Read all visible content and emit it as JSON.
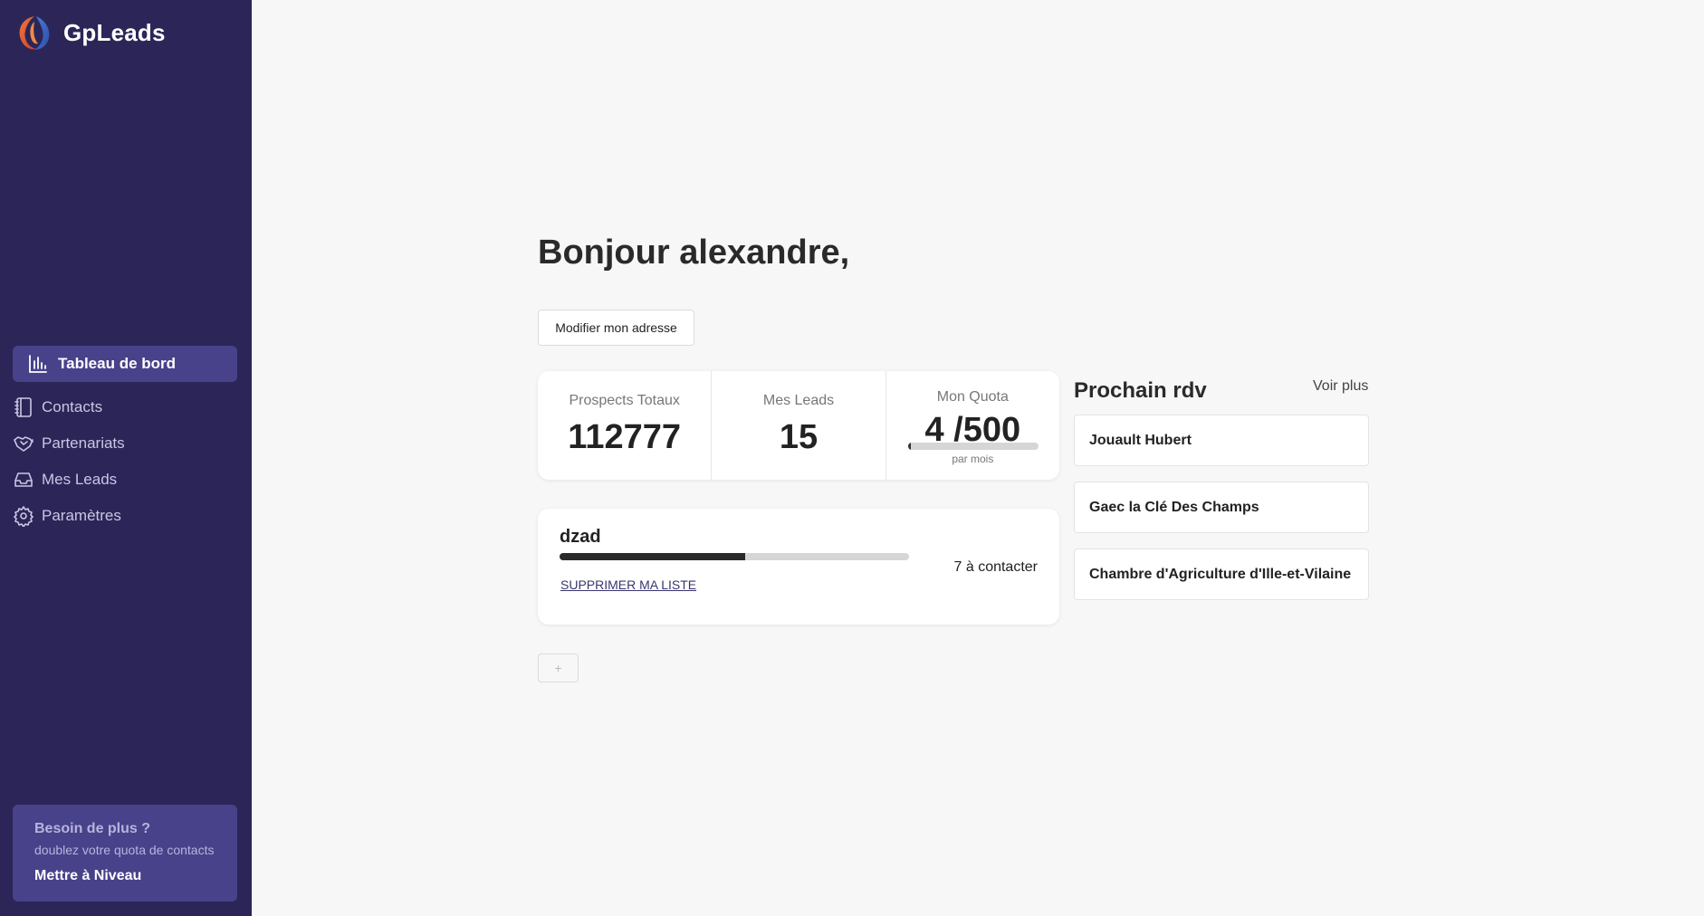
{
  "app": {
    "name": "GpLeads"
  },
  "sidebar": {
    "items": [
      {
        "label": "Tableau de bord",
        "icon": "bar-chart-icon",
        "active": true
      },
      {
        "label": "Contacts",
        "icon": "address-book-icon"
      },
      {
        "label": "Partenariats",
        "icon": "handshake-icon"
      },
      {
        "label": "Mes Leads",
        "icon": "inbox-icon"
      },
      {
        "label": "Paramètres",
        "icon": "gear-icon"
      }
    ],
    "upgrade": {
      "title": "Besoin de plus ?",
      "subtitle": "doublez votre quota de contacts",
      "button": "Mettre à Niveau"
    }
  },
  "main": {
    "greeting": "Bonjour alexandre,",
    "address_button": "Modifier mon adresse",
    "stats": {
      "prospects_label": "Prospects Totaux",
      "prospects_value": "112777",
      "leads_label": "Mes Leads",
      "leads_value": "15",
      "quota_label": "Mon Quota",
      "quota_value": "4 /500",
      "quota_used": 4,
      "quota_total": 500,
      "quota_note": "par mois"
    },
    "list": {
      "name": "dzad",
      "progress": 0.53,
      "delete_label": "SUPPRIMER MA LISTE",
      "count_label": "7 à contacter"
    },
    "add_button": "+"
  },
  "rdv": {
    "title": "Prochain rdv",
    "more": "Voir plus",
    "items": [
      "Jouault Hubert",
      "Gaec la Clé Des Champs",
      "Chambre d'Agriculture d'Ille-et-Vilaine"
    ]
  },
  "colors": {
    "sidebar_bg": "#2b2657",
    "sidebar_active": "#48428a",
    "page_bg": "#f7f7f7"
  }
}
